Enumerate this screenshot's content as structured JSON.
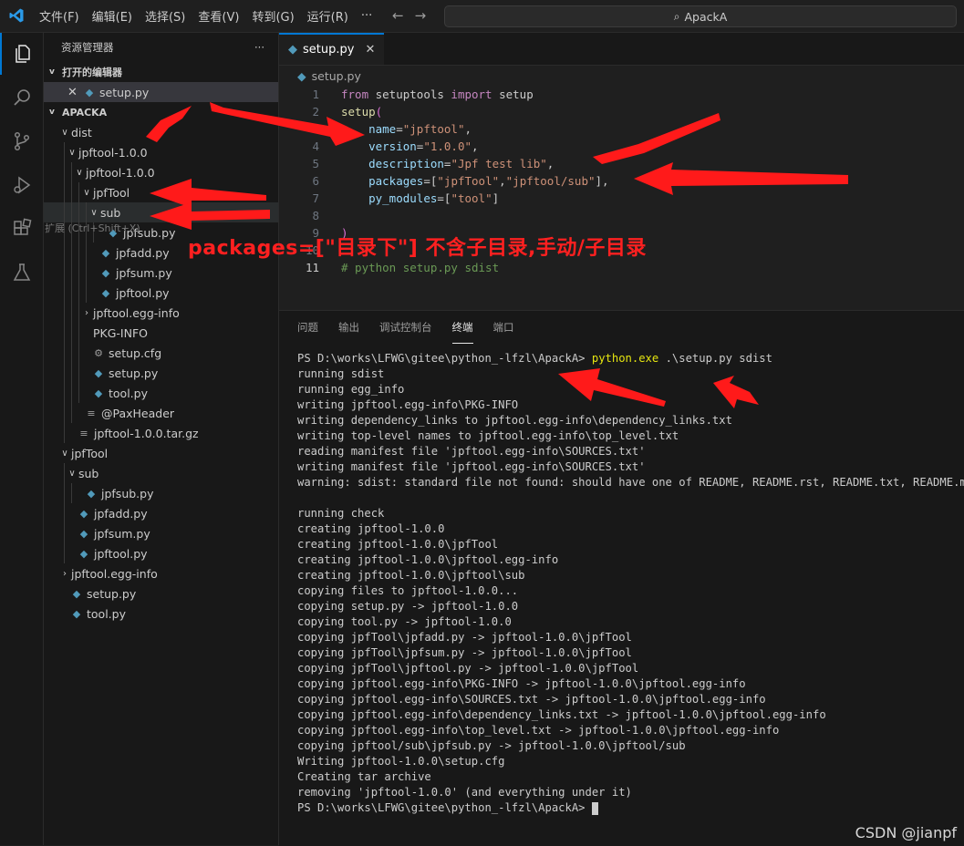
{
  "menu": [
    "文件(F)",
    "编辑(E)",
    "选择(S)",
    "查看(V)",
    "转到(G)",
    "运行(R)",
    "···"
  ],
  "search": {
    "text": "ApackA"
  },
  "sidebar": {
    "title": "资源管理器",
    "more": "···",
    "open_editors_header": "打开的编辑器",
    "open_file": "setup.py",
    "project_header": "APACKA"
  },
  "tree": [
    {
      "label": "dist",
      "twisty": "v",
      "depth": 1,
      "icon": ""
    },
    {
      "label": "jpftool-1.0.0",
      "twisty": "v",
      "depth": 2,
      "icon": ""
    },
    {
      "label": "jpftool-1.0.0",
      "twisty": "v",
      "depth": 3,
      "icon": ""
    },
    {
      "label": "jpfTool",
      "twisty": "v",
      "depth": 4,
      "icon": ""
    },
    {
      "label": "sub",
      "twisty": "v",
      "depth": 5,
      "icon": "",
      "highlight": true
    },
    {
      "label": "jpfsub.py",
      "twisty": "",
      "depth": 6,
      "icon": "python"
    },
    {
      "label": "jpfadd.py",
      "twisty": "",
      "depth": 5,
      "icon": "python"
    },
    {
      "label": "jpfsum.py",
      "twisty": "",
      "depth": 5,
      "icon": "python"
    },
    {
      "label": "jpftool.py",
      "twisty": "",
      "depth": 5,
      "icon": "python"
    },
    {
      "label": "jpftool.egg-info",
      "twisty": ">",
      "depth": 4,
      "icon": ""
    },
    {
      "label": "PKG-INFO",
      "twisty": "",
      "depth": 4,
      "icon": ""
    },
    {
      "label": "setup.cfg",
      "twisty": "",
      "depth": 4,
      "icon": "gear"
    },
    {
      "label": "setup.py",
      "twisty": "",
      "depth": 4,
      "icon": "python"
    },
    {
      "label": "tool.py",
      "twisty": "",
      "depth": 4,
      "icon": "python"
    },
    {
      "label": "@PaxHeader",
      "twisty": "",
      "depth": 3,
      "icon": "lines"
    },
    {
      "label": "jpftool-1.0.0.tar.gz",
      "twisty": "",
      "depth": 2,
      "icon": "lines"
    },
    {
      "label": "jpfTool",
      "twisty": "v",
      "depth": 1,
      "icon": ""
    },
    {
      "label": "sub",
      "twisty": "v",
      "depth": 2,
      "icon": ""
    },
    {
      "label": "jpfsub.py",
      "twisty": "",
      "depth": 3,
      "icon": "python"
    },
    {
      "label": "jpfadd.py",
      "twisty": "",
      "depth": 2,
      "icon": "python"
    },
    {
      "label": "jpfsum.py",
      "twisty": "",
      "depth": 2,
      "icon": "python"
    },
    {
      "label": "jpftool.py",
      "twisty": "",
      "depth": 2,
      "icon": "python"
    },
    {
      "label": "jpftool.egg-info",
      "twisty": ">",
      "depth": 1,
      "icon": ""
    },
    {
      "label": "setup.py",
      "twisty": "",
      "depth": 1,
      "icon": "python"
    },
    {
      "label": "tool.py",
      "twisty": "",
      "depth": 1,
      "icon": "python"
    }
  ],
  "hover_text": "扩展 (Ctrl+Shift+X)",
  "editor": {
    "tab_label": "setup.py",
    "breadcrumb": "setup.py",
    "current_line": 11,
    "lines": [
      [
        [
          "from",
          "kw"
        ],
        [
          " setuptools ",
          "pn"
        ],
        [
          "import",
          "kw"
        ],
        [
          " setup",
          "pn"
        ]
      ],
      [
        [
          "setup",
          "fn"
        ],
        [
          "(",
          "br"
        ]
      ],
      [
        [
          "    ",
          "pn"
        ],
        [
          "name",
          "pm"
        ],
        [
          "=",
          "pn"
        ],
        [
          "\"jpftool\"",
          "st"
        ],
        [
          ",",
          "pn"
        ]
      ],
      [
        [
          "    ",
          "pn"
        ],
        [
          "version",
          "pm"
        ],
        [
          "=",
          "pn"
        ],
        [
          "\"1.0.0\"",
          "st"
        ],
        [
          ",",
          "pn"
        ]
      ],
      [
        [
          "    ",
          "pn"
        ],
        [
          "description",
          "pm"
        ],
        [
          "=",
          "pn"
        ],
        [
          "\"Jpf test lib\"",
          "st"
        ],
        [
          ",",
          "pn"
        ]
      ],
      [
        [
          "    ",
          "pn"
        ],
        [
          "packages",
          "pm"
        ],
        [
          "=[",
          "pn"
        ],
        [
          "\"jpfTool\"",
          "st"
        ],
        [
          ",",
          "pn"
        ],
        [
          "\"jpftool/sub\"",
          "st"
        ],
        [
          "],",
          "pn"
        ]
      ],
      [
        [
          "    ",
          "pn"
        ],
        [
          "py_modules",
          "pm"
        ],
        [
          "=[",
          "pn"
        ],
        [
          "\"tool\"",
          "st"
        ],
        [
          "]",
          "pn"
        ]
      ],
      [
        [
          "",
          "pn"
        ]
      ],
      [
        [
          ")",
          "br"
        ]
      ],
      [
        [
          "",
          "pn"
        ]
      ],
      [
        [
          "# python setup.py sdist",
          "cm"
        ]
      ]
    ]
  },
  "panel": {
    "tabs": [
      "问题",
      "输出",
      "调试控制台",
      "终端",
      "端口"
    ],
    "active_tab": 3
  },
  "terminal": {
    "prompt": "PS D:\\works\\LFWG\\gitee\\python_-lfzl\\ApackA>",
    "command_exe": "python.exe",
    "command_args": " .\\setup.py sdist",
    "lines": [
      "running sdist",
      "running egg_info",
      "writing jpftool.egg-info\\PKG-INFO",
      "writing dependency_links to jpftool.egg-info\\dependency_links.txt",
      "writing top-level names to jpftool.egg-info\\top_level.txt",
      "reading manifest file 'jpftool.egg-info\\SOURCES.txt'",
      "writing manifest file 'jpftool.egg-info\\SOURCES.txt'",
      "warning: sdist: standard file not found: should have one of README, README.rst, README.txt, README.md",
      "",
      "running check",
      "creating jpftool-1.0.0",
      "creating jpftool-1.0.0\\jpfTool",
      "creating jpftool-1.0.0\\jpftool.egg-info",
      "creating jpftool-1.0.0\\jpftool\\sub",
      "copying files to jpftool-1.0.0...",
      "copying setup.py -> jpftool-1.0.0",
      "copying tool.py -> jpftool-1.0.0",
      "copying jpfTool\\jpfadd.py -> jpftool-1.0.0\\jpfTool",
      "copying jpfTool\\jpfsum.py -> jpftool-1.0.0\\jpfTool",
      "copying jpfTool\\jpftool.py -> jpftool-1.0.0\\jpfTool",
      "copying jpftool.egg-info\\PKG-INFO -> jpftool-1.0.0\\jpftool.egg-info",
      "copying jpftool.egg-info\\SOURCES.txt -> jpftool-1.0.0\\jpftool.egg-info",
      "copying jpftool.egg-info\\dependency_links.txt -> jpftool-1.0.0\\jpftool.egg-info",
      "copying jpftool.egg-info\\top_level.txt -> jpftool-1.0.0\\jpftool.egg-info",
      "copying jpftool/sub\\jpfsub.py -> jpftool-1.0.0\\jpftool/sub",
      "Writing jpftool-1.0.0\\setup.cfg",
      "Creating tar archive",
      "removing 'jpftool-1.0.0' (and everything under it)"
    ],
    "final_prompt": "PS D:\\works\\LFWG\\gitee\\python_-lfzl\\ApackA>"
  },
  "annotation": "packages=[\"目录下\"] 不含子目录,手动/子目录",
  "watermark": "CSDN @jianpf",
  "colors": {
    "accent": "#0078d4",
    "annotation": "#ff2020",
    "arrow": "#ff1a1a"
  }
}
